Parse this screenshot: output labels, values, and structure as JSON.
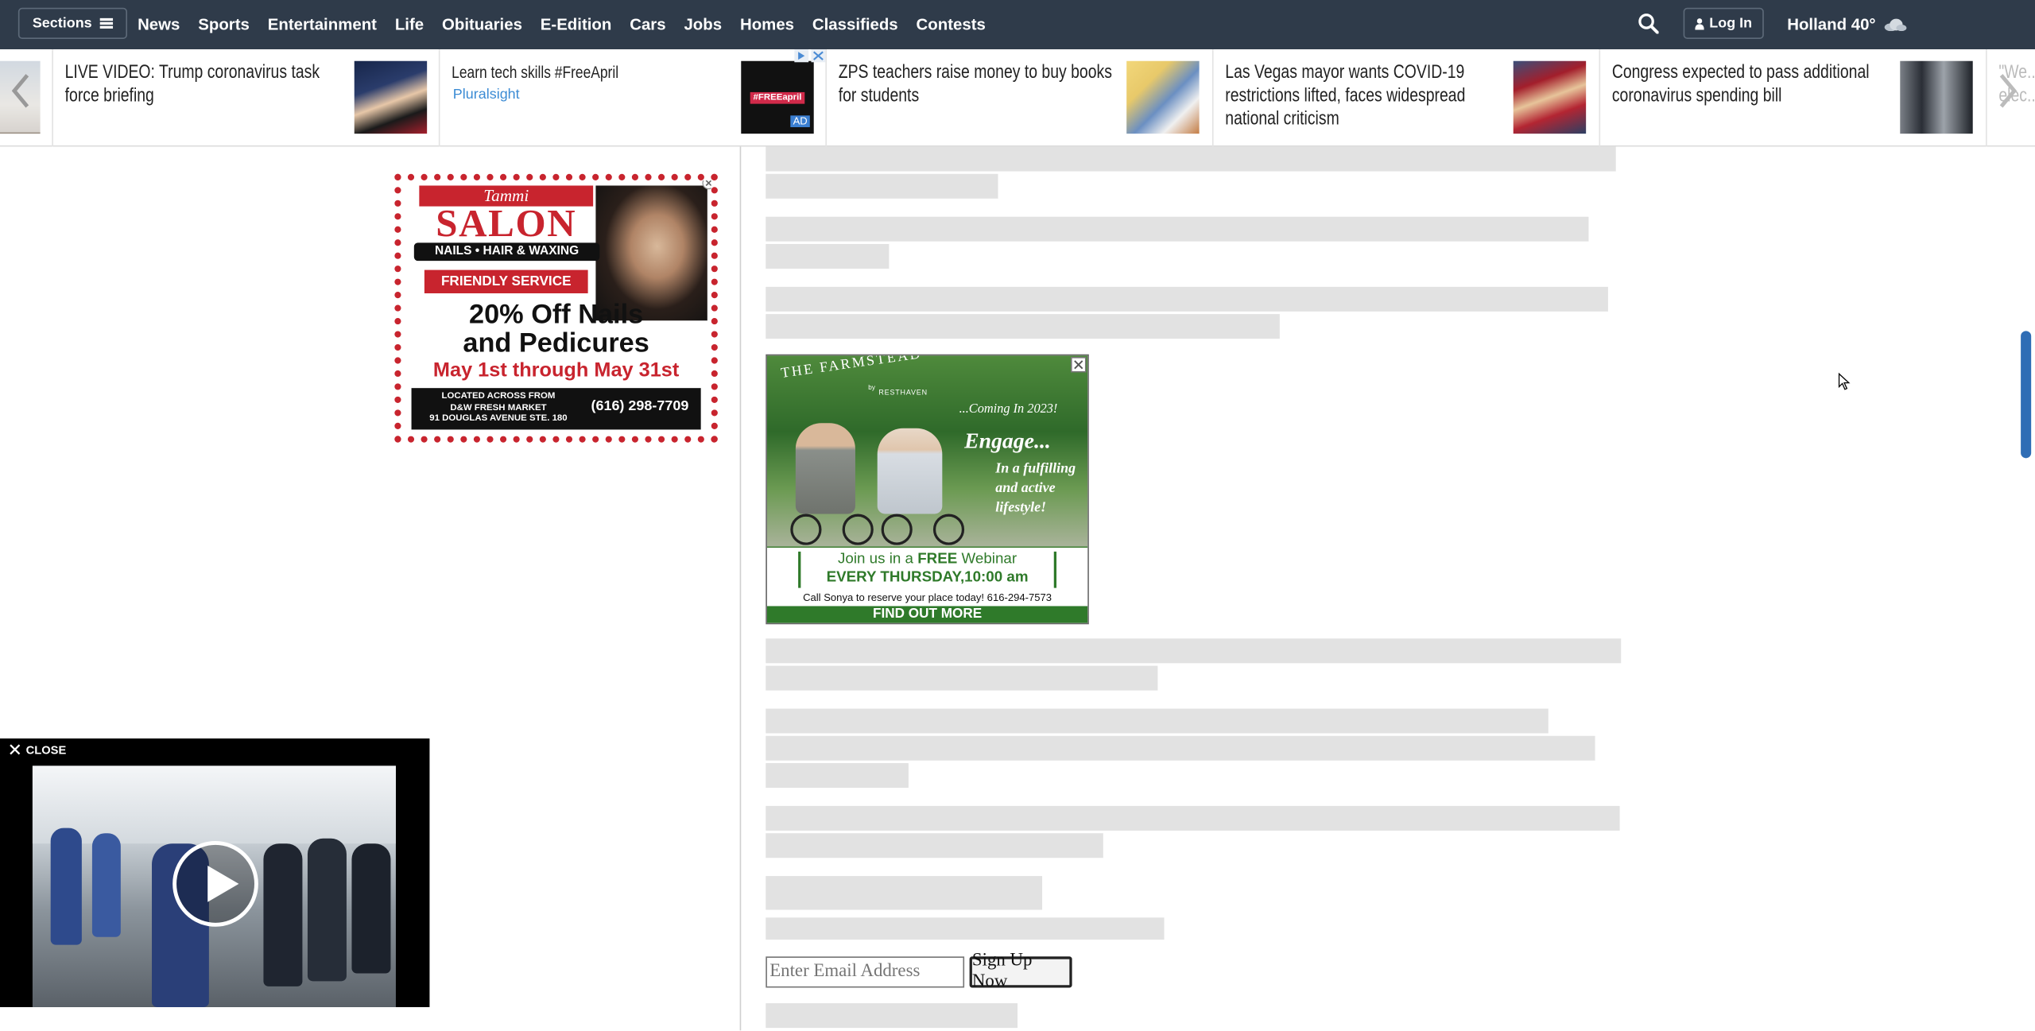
{
  "topnav": {
    "sections_label": "Sections",
    "links": [
      "News",
      "Sports",
      "Entertainment",
      "Life",
      "Obituaries",
      "E-Edition",
      "Cars",
      "Jobs",
      "Homes",
      "Classifieds",
      "Contests"
    ],
    "login_label": "Log In",
    "weather_label": "Holland 40°",
    "bg_color": "#2f3b4a"
  },
  "ticker": {
    "items": [
      {
        "text": "LIVE VIDEO: Trump coronavirus task force briefing"
      },
      {
        "text": "Learn tech skills #FreeApril",
        "sponsor": "Pluralsight",
        "ad_thumb_text": "#FREEapril",
        "ad_badge": "AD"
      },
      {
        "text": "ZPS teachers raise money to buy books for students"
      },
      {
        "text": "Las Vegas mayor wants COVID-19 restrictions lifted, faces widespread national criticism"
      },
      {
        "text": "Congress expected to pass additional coronavirus spending bill"
      },
      {
        "text": "\"We... elec..."
      }
    ]
  },
  "salon_ad": {
    "brand": "Tammi",
    "name": "SALON",
    "services": "NAILS • HAIR & WAXING",
    "tagline": "FRIENDLY SERVICE",
    "offer_line1": "20% Off Nails",
    "offer_line2": "and Pedicures",
    "dates": "May 1st through May 31st",
    "location_line1": "LOCATED ACROSS FROM",
    "location_line2": "D&W FRESH MARKET",
    "location_line3": "91 DOUGLAS AVENUE STE. 180",
    "phone": "(616) 298-7709"
  },
  "farmstead_ad": {
    "title": "THE FARMSTEAD",
    "by": "by",
    "company": "RESTHAVEN",
    "coming": "...Coming In 2023!",
    "engage": "Engage...",
    "engage_body": "In a fulfilling and active lifestyle!",
    "webinar_line1_pre": "Join us in a ",
    "webinar_free": "FREE",
    "webinar_line1_post": " Webinar",
    "webinar_line2": "EVERY THURSDAY,10:00 am",
    "call_line": "Call Sonya to reserve your place today! 616-294-7573",
    "cta": "FIND OUT MORE"
  },
  "newsletter": {
    "email_placeholder": "Enter Email Address",
    "signup_label": "Sign Up Now"
  },
  "video": {
    "close_label": "CLOSE"
  }
}
